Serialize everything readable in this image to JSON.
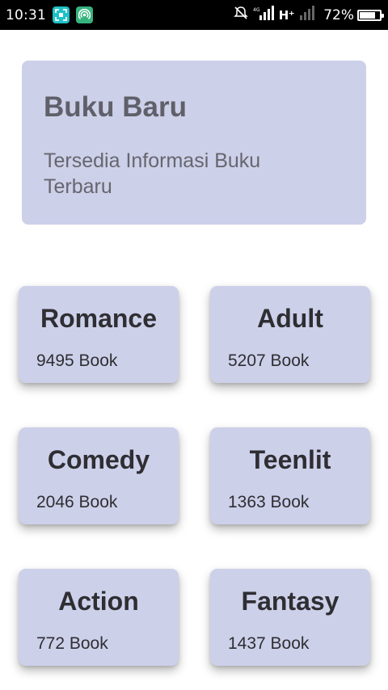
{
  "status_bar": {
    "time": "10:31",
    "network": "H⁺",
    "battery_percent": "72%",
    "battery_level": 0.72,
    "icons": [
      "screenshot-icon",
      "hotspot-icon",
      "mute-icon",
      "signal-icon",
      "signal-icon-2"
    ]
  },
  "header": {
    "title": "Buku Baru",
    "subtitle": "Tersedia Informasi Buku Terbaru"
  },
  "categories": [
    {
      "name": "Romance",
      "count": "9495 Book"
    },
    {
      "name": "Adult",
      "count": "5207 Book"
    },
    {
      "name": "Comedy",
      "count": "2046 Book"
    },
    {
      "name": "Teenlit",
      "count": "1363 Book"
    },
    {
      "name": "Action",
      "count": "772 Book"
    },
    {
      "name": "Fantasy",
      "count": "1437 Book"
    }
  ],
  "colors": {
    "card_bg": "#cdd0e9",
    "app_icon_teal": "#1fc0c8",
    "app_icon_green": "#36b37e"
  }
}
